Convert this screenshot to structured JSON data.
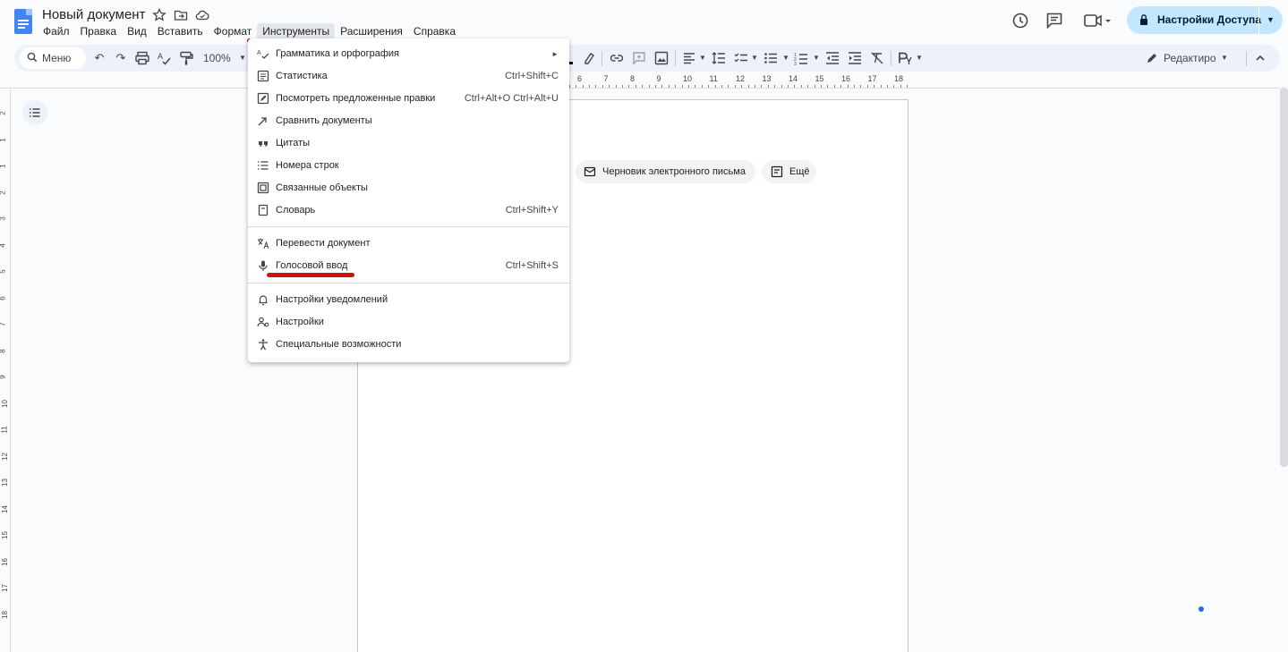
{
  "app": {
    "doc_title": "Новый документ",
    "menu": [
      "Файл",
      "Правка",
      "Вид",
      "Вставить",
      "Формат",
      "Инструменты",
      "Расширения",
      "Справка"
    ],
    "active_menu": "Инструменты"
  },
  "share": {
    "label": "Настройки Доступа"
  },
  "toolbar": {
    "search_label": "Меню",
    "zoom": "100%",
    "edit_mode_label": "Редактиро"
  },
  "ruler": {
    "h_ticks": [
      "6",
      "7",
      "8",
      "9",
      "10",
      "11",
      "12",
      "13",
      "14",
      "15",
      "16",
      "17",
      "18"
    ],
    "v_ticks": [
      "2",
      "1",
      "1",
      "2",
      "3",
      "4",
      "5",
      "6",
      "7",
      "8",
      "9",
      "10",
      "11",
      "12",
      "13",
      "14",
      "15",
      "16",
      "17",
      "18"
    ]
  },
  "chips": {
    "email_draft": "Черновик электронного письма",
    "more": "Ещё"
  },
  "tools_menu": {
    "items": [
      {
        "label": "Грамматика и орфография",
        "shortcut": "►",
        "icon": "spellcheck-icon"
      },
      {
        "label": "Статистика",
        "shortcut": "Ctrl+Shift+C",
        "icon": "word-count-icon"
      },
      {
        "label": "Посмотреть предложенные правки",
        "shortcut": "Ctrl+Alt+O Ctrl+Alt+U",
        "icon": "review-edits-icon"
      },
      {
        "label": "Сравнить документы",
        "shortcut": "",
        "icon": "compare-icon"
      },
      {
        "label": "Цитаты",
        "shortcut": "",
        "icon": "quote-icon"
      },
      {
        "label": "Номера строк",
        "shortcut": "",
        "icon": "line-numbers-icon"
      },
      {
        "label": "Связанные объекты",
        "shortcut": "",
        "icon": "linked-objects-icon"
      },
      {
        "label": "Словарь",
        "shortcut": "Ctrl+Shift+Y",
        "icon": "dictionary-icon"
      },
      {
        "label": "Перевести документ",
        "shortcut": "",
        "icon": "translate-icon"
      },
      {
        "label": "Голосовой ввод",
        "shortcut": "Ctrl+Shift+S",
        "icon": "microphone-icon"
      },
      {
        "label": "Настройки уведомлений",
        "shortcut": "",
        "icon": "bell-icon"
      },
      {
        "label": "Настройки",
        "shortcut": "",
        "icon": "settings-people-icon"
      },
      {
        "label": "Специальные возможности",
        "shortcut": "",
        "icon": "accessibility-icon"
      }
    ]
  },
  "colors": {
    "accent": "#c2e7ff",
    "highlight_red": "#d00f0f",
    "toolbar_bg": "#edf2fa"
  }
}
